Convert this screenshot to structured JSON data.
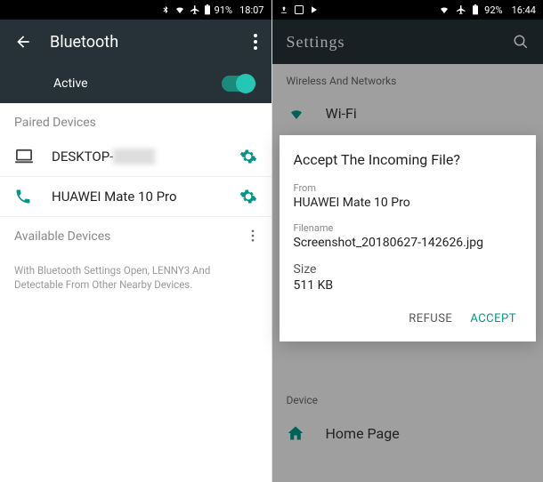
{
  "left": {
    "statusbar": {
      "battery": "91%",
      "time": "18:07"
    },
    "topbar": {
      "title": "Bluetooth"
    },
    "active": {
      "label": "Active"
    },
    "sections": {
      "paired": "Paired Devices",
      "available": "Available Devices"
    },
    "devices": {
      "paired": [
        {
          "name": "DESKTOP-",
          "icon": "laptop"
        },
        {
          "name": "HUAWEI Mate 10 Pro",
          "icon": "phone"
        }
      ]
    },
    "hint": "With Bluetooth Settings Open, LENNY3 And Detectable From Other Nearby Devices."
  },
  "right": {
    "statusbar": {
      "battery": "92%",
      "time": "16:44"
    },
    "topbar": {
      "title": "Settings"
    },
    "categories": {
      "wireless": "Wireless And Networks",
      "device": "Device"
    },
    "items": {
      "wifi": "Wi-Fi",
      "home": "Home Page"
    },
    "dialog": {
      "title": "Accept The Incoming File?",
      "from_label": "From",
      "from_value": "HUAWEI Mate 10 Pro",
      "filename_label": "Filename",
      "filename_value": "Screenshot_20180627-142626.jpg",
      "size_label": "Size",
      "size_value": "511 KB",
      "refuse": "REFUSE",
      "accept": "ACCEPT"
    }
  }
}
